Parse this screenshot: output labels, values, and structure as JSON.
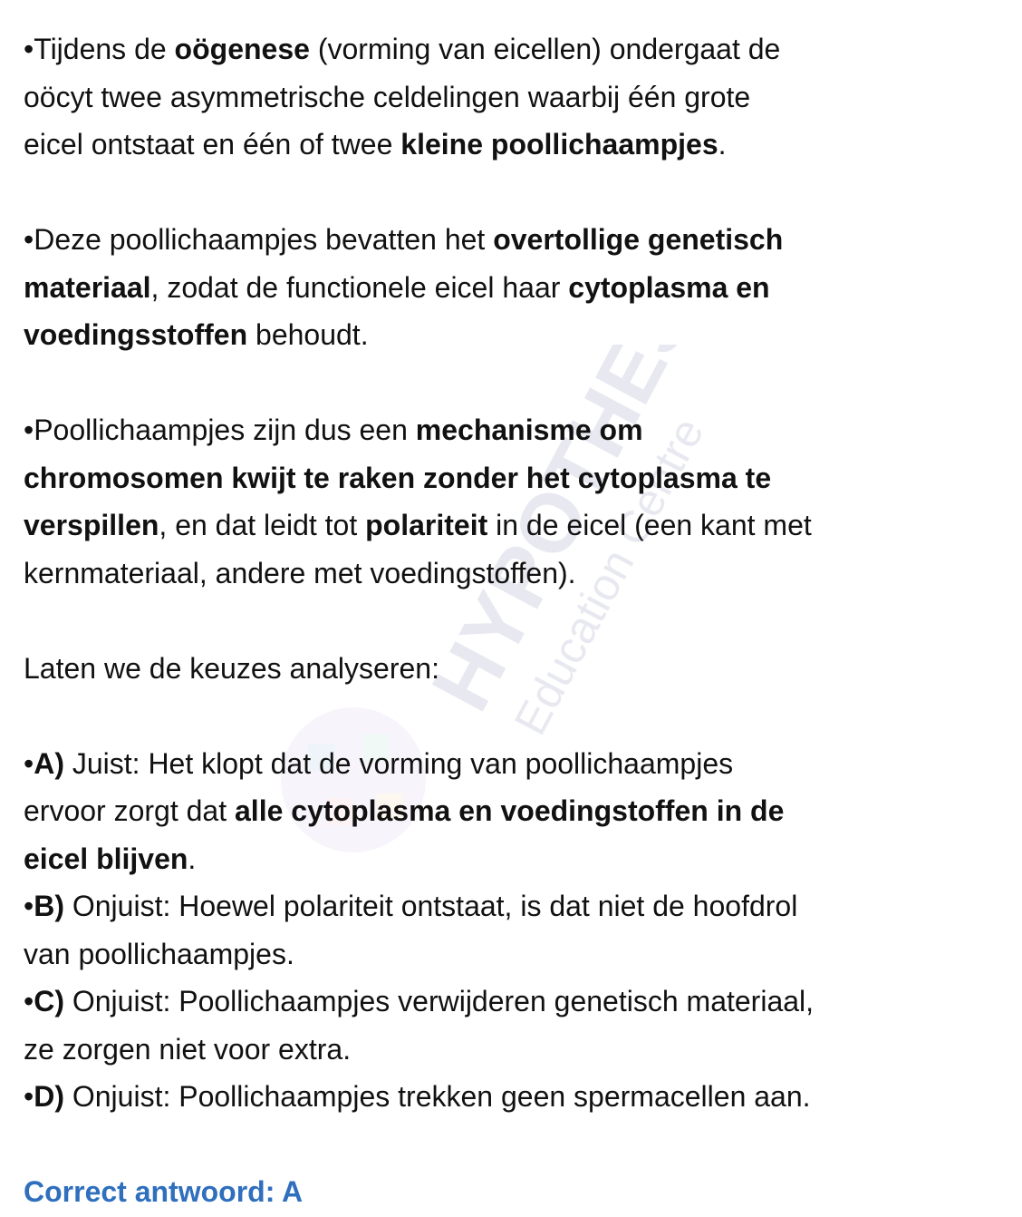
{
  "document": {
    "lines": [
      [
        [
          "•Tijdens de ",
          false
        ],
        [
          "oögenese",
          true
        ],
        [
          " (vorming van eicellen) ondergaat de",
          false
        ]
      ],
      [
        [
          "oöcyt twee asymmetrische celdelingen waarbij één grote",
          false
        ]
      ],
      [
        [
          "eicel ontstaat en één of twee ",
          false
        ],
        [
          "kleine poollichaampjes",
          true
        ],
        [
          ".",
          false
        ]
      ],
      [],
      [
        [
          "•Deze poollichaampjes bevatten het ",
          false
        ],
        [
          "overtollige genetisch",
          true
        ]
      ],
      [
        [
          "materiaal",
          true
        ],
        [
          ", zodat de functionele eicel haar ",
          false
        ],
        [
          "cytoplasma en",
          true
        ]
      ],
      [
        [
          "voedingsstoffen",
          true
        ],
        [
          " behoudt.",
          false
        ]
      ],
      [],
      [
        [
          "•Poollichaampjes zijn dus een ",
          false
        ],
        [
          "mechanisme om",
          true
        ]
      ],
      [
        [
          "chromosomen kwijt te raken zonder het cytoplasma te",
          true
        ]
      ],
      [
        [
          "verspillen",
          true
        ],
        [
          ", en dat leidt tot ",
          false
        ],
        [
          "polariteit",
          true
        ],
        [
          " in de eicel (een kant met",
          false
        ]
      ],
      [
        [
          "kernmateriaal, andere met voedingstoffen).",
          false
        ]
      ],
      [],
      [
        [
          "Laten we de keuzes analyseren:",
          false
        ]
      ],
      [],
      [
        [
          "•",
          false
        ],
        [
          "A)",
          true
        ],
        [
          " Juist: Het klopt dat de vorming van poollichaampjes",
          false
        ]
      ],
      [
        [
          "ervoor zorgt dat ",
          false
        ],
        [
          "alle cytoplasma en voedingstoffen in de",
          true
        ]
      ],
      [
        [
          "eicel blijven",
          true
        ],
        [
          ".",
          false
        ]
      ],
      [
        [
          "•",
          false
        ],
        [
          "B)",
          true
        ],
        [
          " Onjuist: Hoewel polariteit ontstaat, is dat niet de hoofdrol",
          false
        ]
      ],
      [
        [
          "van poollichaampjes.",
          false
        ]
      ],
      [
        [
          "•",
          false
        ],
        [
          "C)",
          true
        ],
        [
          " Onjuist: Poollichaampjes verwijderen genetisch materiaal,",
          false
        ]
      ],
      [
        [
          "ze zorgen niet voor extra.",
          false
        ]
      ],
      [
        [
          "•",
          false
        ],
        [
          "D)",
          true
        ],
        [
          " Onjuist: Poollichaampjes trekken geen spermacellen aan.",
          false
        ]
      ],
      []
    ],
    "answer": "Correct antwoord: A",
    "answer_color": "#2f6fbd"
  },
  "watermark": {
    "title": "HYPOTHESE",
    "subtitle": "Education Centre"
  }
}
